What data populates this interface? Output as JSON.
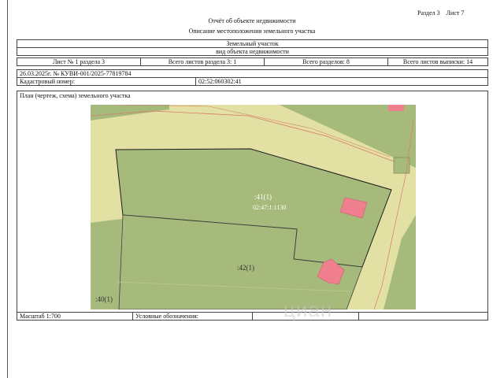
{
  "header": {
    "section_sheet": "Раздел 3    Лист 7",
    "title": "Отчёт об объекте недвижимости",
    "subtitle": "Описание местоположения земельного участка"
  },
  "object": {
    "name": "Земельный участок",
    "type_caption": "вид объекта недвижимости"
  },
  "sheets": {
    "sheet": "Лист № 1 раздела 3",
    "total_in_section": "Всего листов раздела 3: 1",
    "total_sections": "Всего разделов: 8",
    "total_sheets": "Всего листов выписки: 14"
  },
  "record": {
    "date_number": "26.03.2025г. № КУВИ-001/2025-77819784",
    "cadastral_label": "Кадастровый номер:",
    "cadastral_value": "02:52:060302:41"
  },
  "plan": {
    "title": "План (чертеж, схема) земельного участка",
    "labels": {
      "parcel_main": ":41(1)",
      "parcel_main_sub": "02:47:1:1130",
      "parcel_mid": ":42(1)",
      "parcel_left": ":40(1)"
    }
  },
  "footer": {
    "scale": "Масштаб 1:700",
    "legend": "Условные обозначения:"
  },
  "watermark": "циан",
  "colors": {
    "road": "#e3e0a3",
    "parcel": "#a6ba7b",
    "building": "#ef7f8e",
    "boundary_red": "#d97b6b"
  }
}
